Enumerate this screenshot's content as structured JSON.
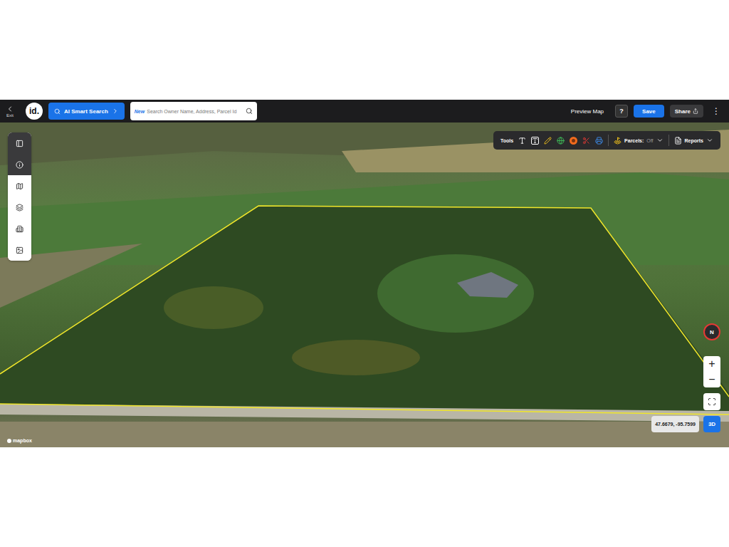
{
  "header": {
    "exit": {
      "icon": "<",
      "label": "Exit"
    },
    "logo": "id.",
    "ai_search": "AI Smart Search",
    "search": {
      "badge": "New",
      "placeholder": "Search Owner Name, Address, Parcel Id"
    },
    "preview": "Preview Map",
    "help": "?",
    "save": "Save",
    "share": "Share",
    "more": "⋮"
  },
  "sidebar": {
    "items": [
      {
        "highlighted": true
      },
      {
        "highlighted": true
      },
      {
        "highlighted": false
      },
      {
        "highlighted": false
      },
      {
        "highlighted": false
      },
      {
        "highlighted": false
      }
    ]
  },
  "tools": {
    "label": "Tools",
    "parcels": {
      "label": "Parcels:",
      "state": "Off"
    },
    "reports": "Reports"
  },
  "map": {
    "compass": "N",
    "zoom_in": "+",
    "zoom_out": "−",
    "coordinates": "47.6679, -95.7599",
    "view_mode": "3D",
    "attribution": "mapbox"
  }
}
